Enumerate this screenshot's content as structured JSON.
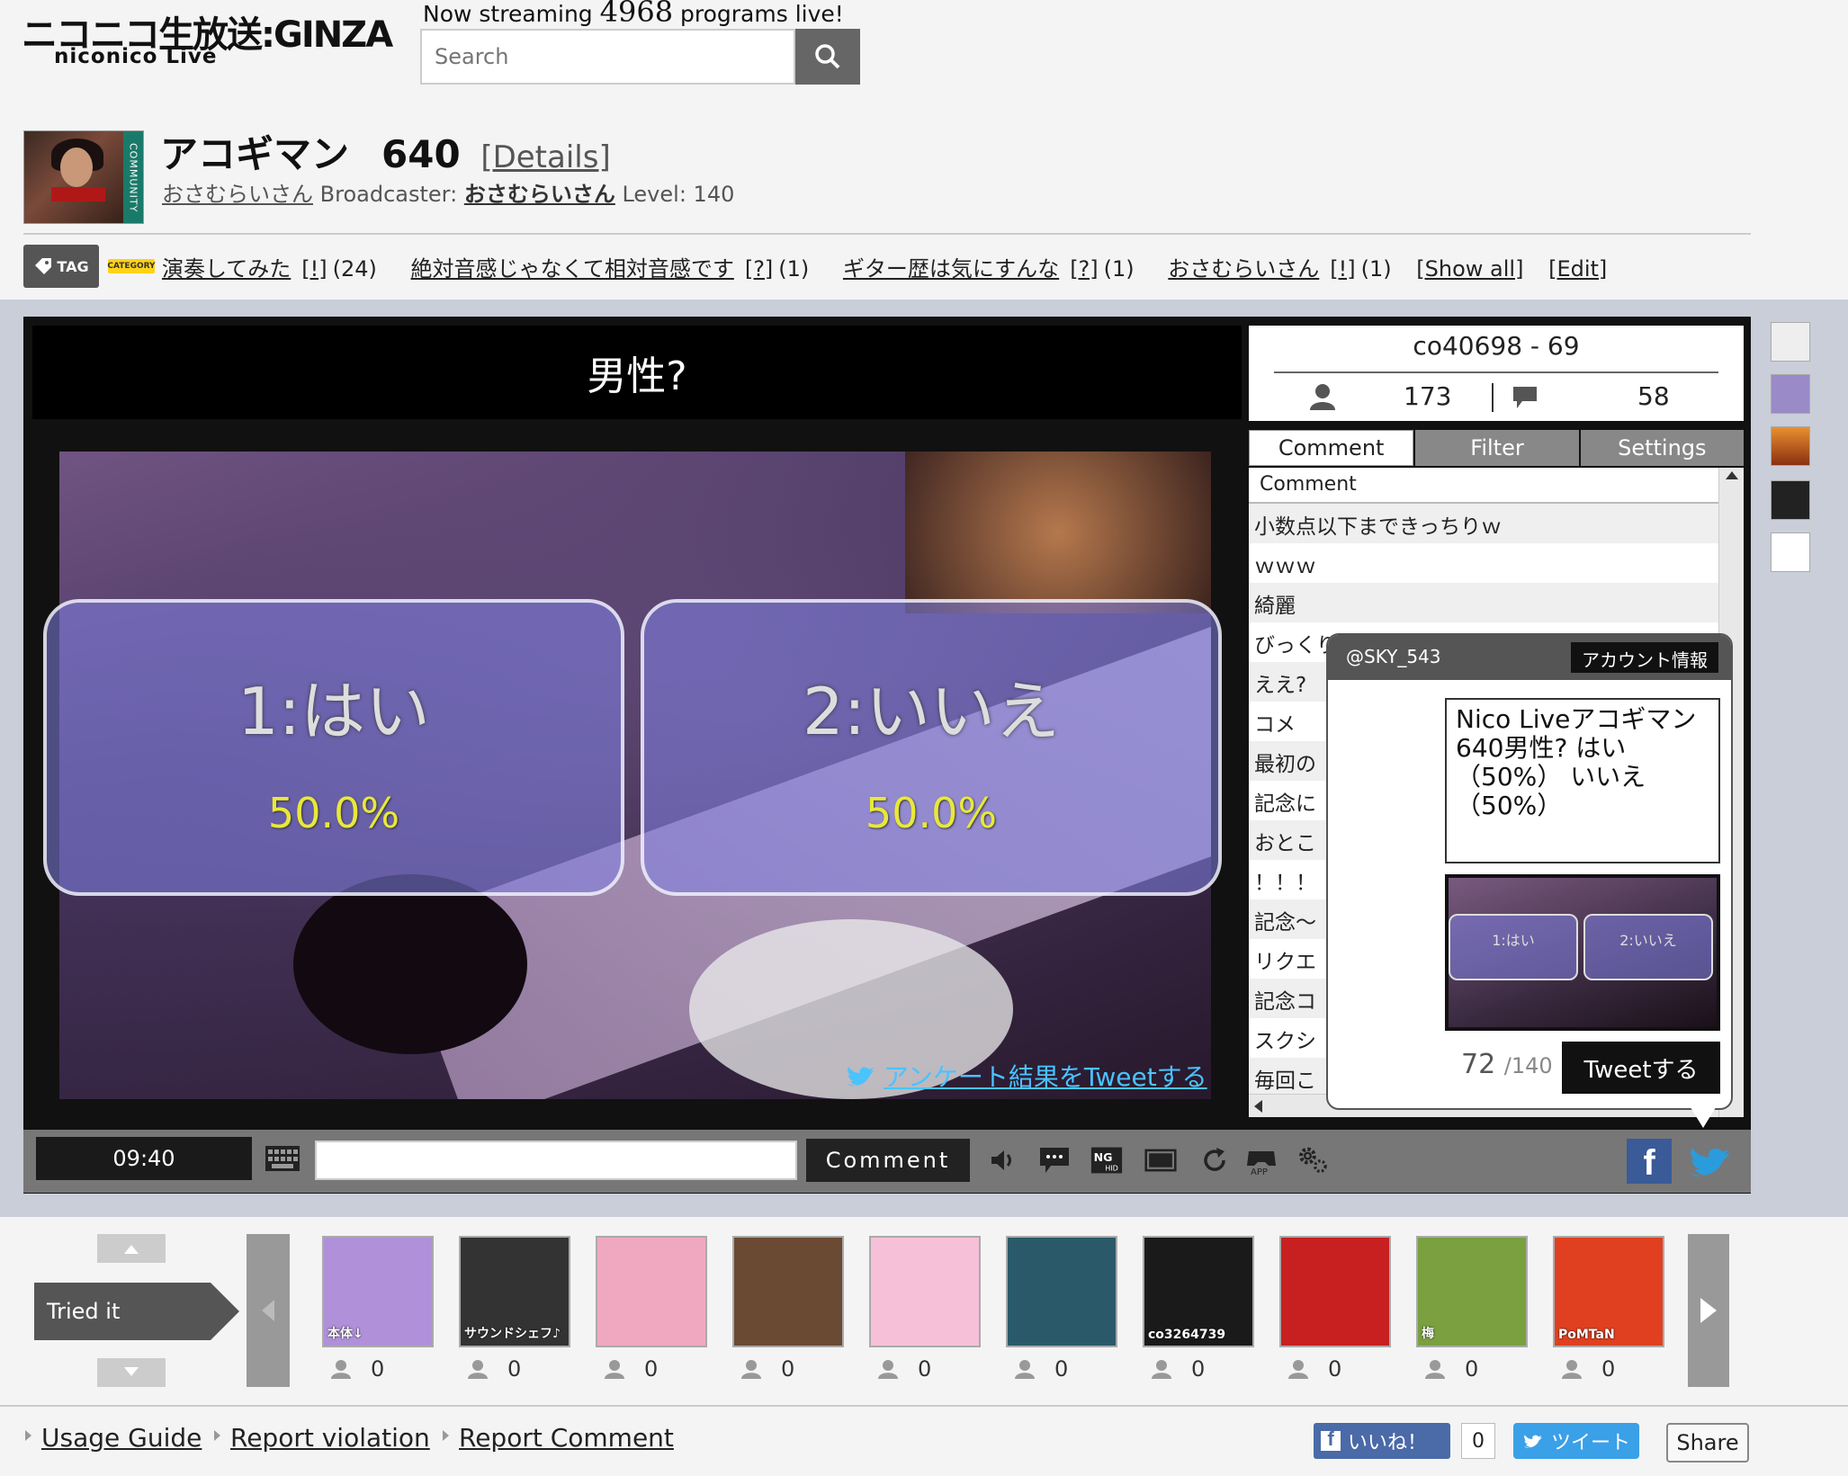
{
  "header": {
    "logo_main": "ニコニコ生放送:GINZA",
    "logo_sub": "niconico Live",
    "streaming_prefix": "Now streaming",
    "streaming_count": "4968",
    "streaming_suffix": "programs live!",
    "search_placeholder": "Search"
  },
  "program": {
    "thumb_band": "COMMUNITY",
    "title": "アコギマン",
    "number": "640",
    "details_link": "[Details]",
    "community_name": "おさむらいさん",
    "broadcaster_label": "Broadcaster:",
    "broadcaster_name": "おさむらいさん",
    "level_label": "Level:",
    "level": "140"
  },
  "tags": {
    "tag_label": "TAG",
    "category_label": "CATEGORY",
    "items": [
      {
        "name": "演奏してみた",
        "mark": "[!]",
        "count": "(24)"
      },
      {
        "name": "絶対音感じゃなくて相対音感です",
        "mark": "[?]",
        "count": "(1)"
      },
      {
        "name": "ギター歴は気にすんな",
        "mark": "[?]",
        "count": "(1)"
      },
      {
        "name": "おさむらいさん",
        "mark": "[!]",
        "count": "(1)"
      }
    ],
    "show_all": "[Show all]",
    "edit": "[Edit]"
  },
  "player": {
    "question": "男性?",
    "options": [
      {
        "label": "1:はい",
        "percent": "50.0%"
      },
      {
        "label": "2:いいえ",
        "percent": "50.0%"
      }
    ],
    "tweet_results": "アンケート結果をTweetする",
    "time": "09:40",
    "comment_button": "Comment"
  },
  "panel": {
    "community_id": "co40698 - 69",
    "viewers": "173",
    "comments": "58",
    "tabs": [
      "Comment",
      "Filter",
      "Settings"
    ],
    "column_header": "Comment",
    "comment_rows": [
      "小数点以下まできっちりｗ",
      "ｗｗｗ",
      "綺麗",
      "びっくりした〜ｗ",
      "ええ?",
      "コメ",
      "最初の",
      "記念に",
      "おとこ",
      "！！！",
      "記念〜",
      "リクエ",
      "記念コ",
      "スクシ",
      "毎回こ"
    ]
  },
  "popup": {
    "handle": "@SKY_543",
    "account_info": "アカウント情報",
    "tweet_text": "Nico Liveアコギマン 640男性?  はい（50%） いいえ（50%）",
    "mini_opt1": "1:はい",
    "mini_opt2": "2:いいえ",
    "char_count": "72",
    "char_limit": "/140",
    "tweet_button": "Tweetする"
  },
  "tried": {
    "label": "Tried it",
    "cards": [
      {
        "count": "0",
        "color": "#b090d8"
      },
      {
        "count": "0",
        "color": "#333333"
      },
      {
        "count": "0",
        "color": "#f0a8c0"
      },
      {
        "count": "0",
        "color": "#6a4a32"
      },
      {
        "count": "0",
        "color": "#f6c0d8"
      },
      {
        "count": "0",
        "color": "#2a5a6a"
      },
      {
        "count": "0",
        "color": "#1a1a1a"
      },
      {
        "count": "0",
        "color": "#c82020"
      },
      {
        "count": "0",
        "color": "#7aa040"
      },
      {
        "count": "0",
        "color": "#e04020"
      }
    ],
    "card_texts": [
      "本体↓",
      "サウンドシェフ♪",
      "",
      "",
      "",
      "",
      "co3264739",
      "",
      "梅",
      "PoMTaN"
    ]
  },
  "footer": {
    "links": [
      "Usage Guide",
      "Report violation",
      "Report Comment"
    ],
    "fb_like": "いいね！",
    "fb_count": "0",
    "tweet": "ツイート",
    "share": "Share"
  }
}
